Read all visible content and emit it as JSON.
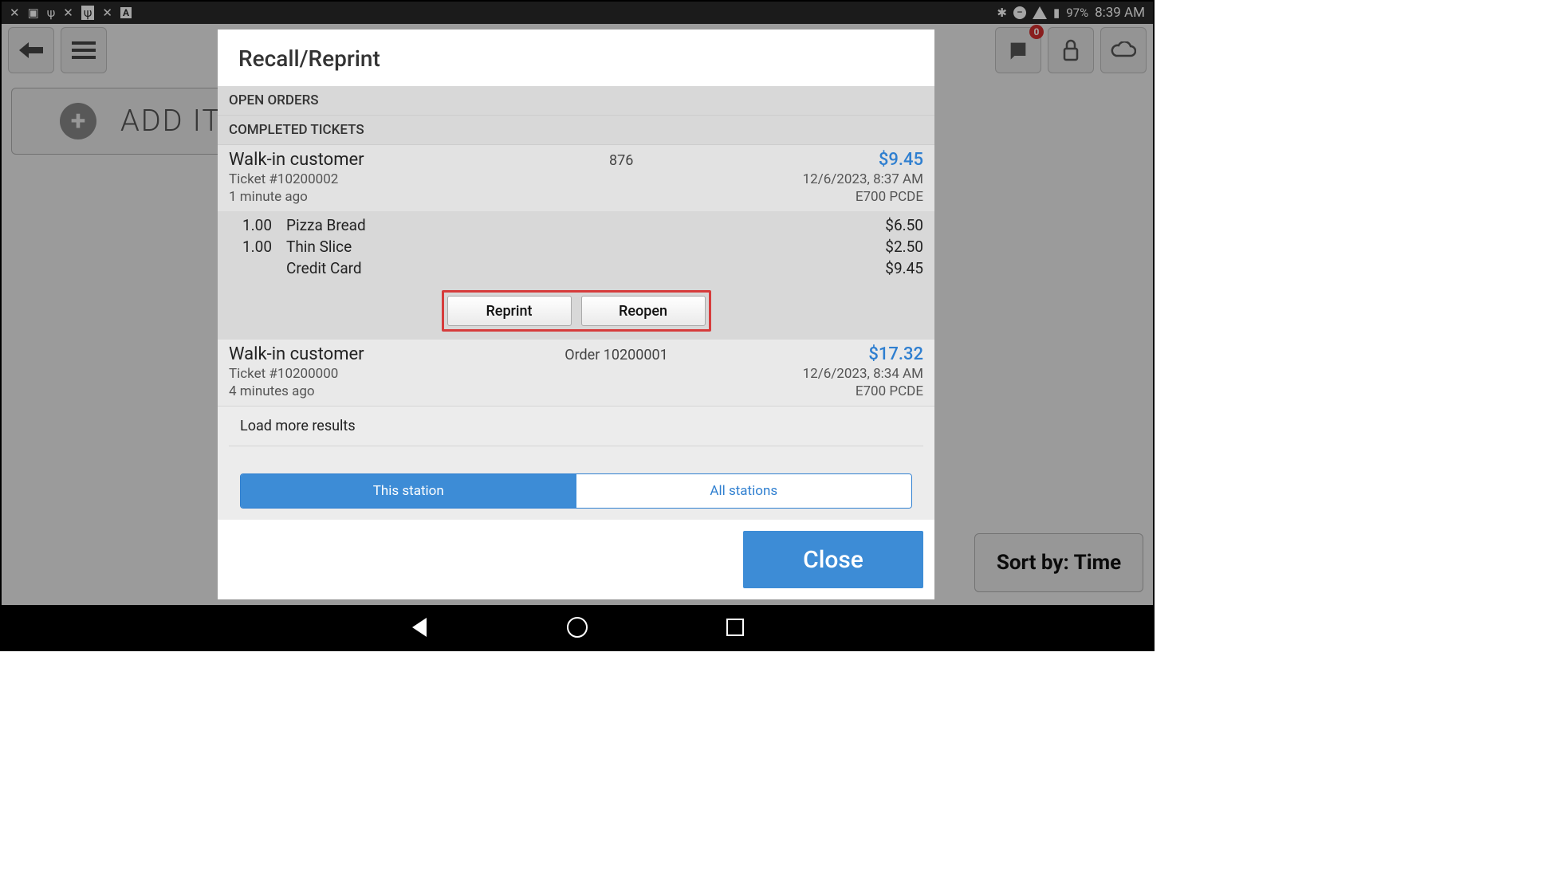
{
  "statusbar": {
    "time": "8:39 AM",
    "battery": "97%"
  },
  "toolbar": {
    "notifications_badge": "0"
  },
  "background": {
    "add_item_label": "ADD ITEM",
    "sort_label": "Sort by: Time"
  },
  "dialog": {
    "title": "Recall/Reprint",
    "sections": {
      "open": "OPEN ORDERS",
      "completed": "COMPLETED TICKETS"
    },
    "tickets": [
      {
        "customer": "Walk-in customer",
        "order_label": "876",
        "amount": "$9.45",
        "ticket_no": "Ticket #10200002",
        "datetime": "12/6/2023, 8:37 AM",
        "ago": "1 minute ago",
        "station": "E700 PCDE",
        "items": [
          {
            "qty": "1.00",
            "name": "Pizza Bread",
            "price": "$6.50"
          },
          {
            "qty": "1.00",
            "name": "Thin Slice",
            "price": "$2.50"
          },
          {
            "qty": "",
            "name": "Credit Card",
            "price": "$9.45"
          }
        ],
        "actions": {
          "reprint": "Reprint",
          "reopen": "Reopen"
        }
      },
      {
        "customer": "Walk-in customer",
        "order_label": "Order 10200001",
        "amount": "$17.32",
        "ticket_no": "Ticket #10200000",
        "datetime": "12/6/2023, 8:34 AM",
        "ago": "4 minutes ago",
        "station": "E700 PCDE"
      }
    ],
    "load_more": "Load more results",
    "filters": {
      "this_station": "This station",
      "all_stations": "All stations"
    },
    "close": "Close"
  }
}
